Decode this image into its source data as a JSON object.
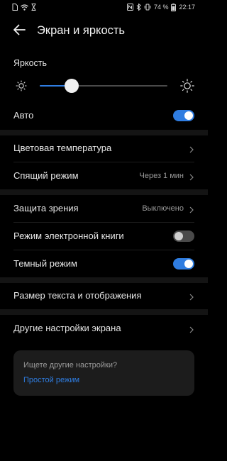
{
  "status_bar": {
    "left_icons": [
      "sim-icon",
      "wifi-icon",
      "hourglass-icon"
    ],
    "right_icons": [
      "nfc-icon",
      "bluetooth-icon",
      "vibrate-icon"
    ],
    "battery": "74 %",
    "time": "22:17"
  },
  "header": {
    "title": "Экран и яркость",
    "back_icon": "back-arrow-icon"
  },
  "brightness": {
    "label": "Яркость",
    "level_percent": 25,
    "low_icon": "sun-low-icon",
    "high_icon": "sun-high-icon"
  },
  "auto": {
    "label": "Авто",
    "on": true
  },
  "color_temperature": {
    "label": "Цветовая температура"
  },
  "sleep": {
    "label": "Спящий режим",
    "value": "Через 1 мин"
  },
  "eye_comfort": {
    "label": "Защита зрения",
    "value": "Выключено"
  },
  "ebook_mode": {
    "label": "Режим электронной книги",
    "on": false
  },
  "dark_mode": {
    "label": "Темный режим",
    "on": true
  },
  "text_size": {
    "label": "Размер текста и отображения"
  },
  "other_settings": {
    "label": "Другие настройки экрана"
  },
  "suggestion": {
    "title": "Ищете другие настройки?",
    "link": "Простой режим"
  },
  "colors": {
    "accent": "#2f7de1",
    "background": "#000000",
    "card": "#1c1c1c"
  }
}
